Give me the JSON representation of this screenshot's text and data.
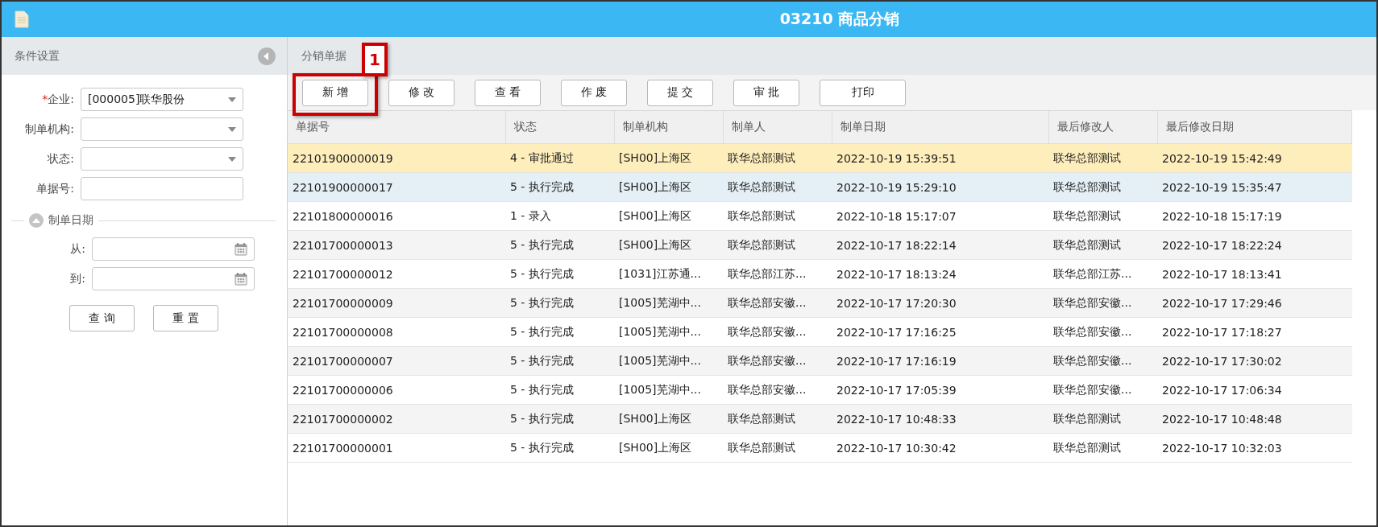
{
  "window": {
    "title": "03210 商品分销"
  },
  "filter_panel": {
    "title": "条件设置",
    "fields": [
      {
        "kind": "select",
        "required_mark": "*",
        "label": "企业:",
        "value": "[000005]联华股份"
      },
      {
        "kind": "select",
        "label": "制单机构:"
      },
      {
        "kind": "select",
        "label": "状态:"
      },
      {
        "kind": "text",
        "label": "单据号:"
      }
    ],
    "date_group": {
      "title": "制单日期",
      "expanded": true,
      "fields": [
        {
          "label": "从:"
        },
        {
          "label": "到:"
        }
      ]
    },
    "buttons": [
      "查 询",
      "重 置"
    ]
  },
  "main": {
    "title": "分销单据",
    "toolbar": [
      "新 增",
      "修 改",
      "查 看",
      "作 废",
      "提 交",
      "审 批",
      "打印"
    ],
    "annotation": {
      "label": "1"
    },
    "table": {
      "columns": [
        "单据号",
        "状态",
        "制单机构",
        "制单人",
        "制单日期",
        "最后修改人",
        "最后修改日期"
      ],
      "rows": [
        {
          "selected": true,
          "hovered": false,
          "cells": [
            "22101900000019",
            "4 - 审批通过",
            "[SH00]上海区",
            "联华总部测试",
            "2022-10-19 15:39:51",
            "联华总部测试",
            "2022-10-19 15:42:49"
          ]
        },
        {
          "selected": false,
          "hovered": true,
          "cells": [
            "22101900000017",
            "5 - 执行完成",
            "[SH00]上海区",
            "联华总部测试",
            "2022-10-19 15:29:10",
            "联华总部测试",
            "2022-10-19 15:35:47"
          ]
        },
        {
          "selected": false,
          "hovered": false,
          "cells": [
            "22101800000016",
            "1 - 录入",
            "[SH00]上海区",
            "联华总部测试",
            "2022-10-18 15:17:07",
            "联华总部测试",
            "2022-10-18 15:17:19"
          ]
        },
        {
          "selected": false,
          "hovered": false,
          "cells": [
            "22101700000013",
            "5 - 执行完成",
            "[SH00]上海区",
            "联华总部测试",
            "2022-10-17 18:22:14",
            "联华总部测试",
            "2022-10-17 18:22:24"
          ]
        },
        {
          "selected": false,
          "hovered": false,
          "cells": [
            "22101700000012",
            "5 - 执行完成",
            "[1031]江苏通...",
            "联华总部江苏...",
            "2022-10-17 18:13:24",
            "联华总部江苏...",
            "2022-10-17 18:13:41"
          ]
        },
        {
          "selected": false,
          "hovered": false,
          "cells": [
            "22101700000009",
            "5 - 执行完成",
            "[1005]芜湖中...",
            "联华总部安徽...",
            "2022-10-17 17:20:30",
            "联华总部安徽...",
            "2022-10-17 17:29:46"
          ]
        },
        {
          "selected": false,
          "hovered": false,
          "cells": [
            "22101700000008",
            "5 - 执行完成",
            "[1005]芜湖中...",
            "联华总部安徽...",
            "2022-10-17 17:16:25",
            "联华总部安徽...",
            "2022-10-17 17:18:27"
          ]
        },
        {
          "selected": false,
          "hovered": false,
          "cells": [
            "22101700000007",
            "5 - 执行完成",
            "[1005]芜湖中...",
            "联华总部安徽...",
            "2022-10-17 17:16:19",
            "联华总部安徽...",
            "2022-10-17 17:30:02"
          ]
        },
        {
          "selected": false,
          "hovered": false,
          "cells": [
            "22101700000006",
            "5 - 执行完成",
            "[1005]芜湖中...",
            "联华总部安徽...",
            "2022-10-17 17:05:39",
            "联华总部安徽...",
            "2022-10-17 17:06:34"
          ]
        },
        {
          "selected": false,
          "hovered": false,
          "cells": [
            "22101700000002",
            "5 - 执行完成",
            "[SH00]上海区",
            "联华总部测试",
            "2022-10-17 10:48:33",
            "联华总部测试",
            "2022-10-17 10:48:48"
          ]
        },
        {
          "selected": false,
          "hovered": false,
          "cells": [
            "22101700000001",
            "5 - 执行完成",
            "[SH00]上海区",
            "联华总部测试",
            "2022-10-17 10:30:42",
            "联华总部测试",
            "2022-10-17 10:32:03"
          ]
        }
      ]
    }
  }
}
